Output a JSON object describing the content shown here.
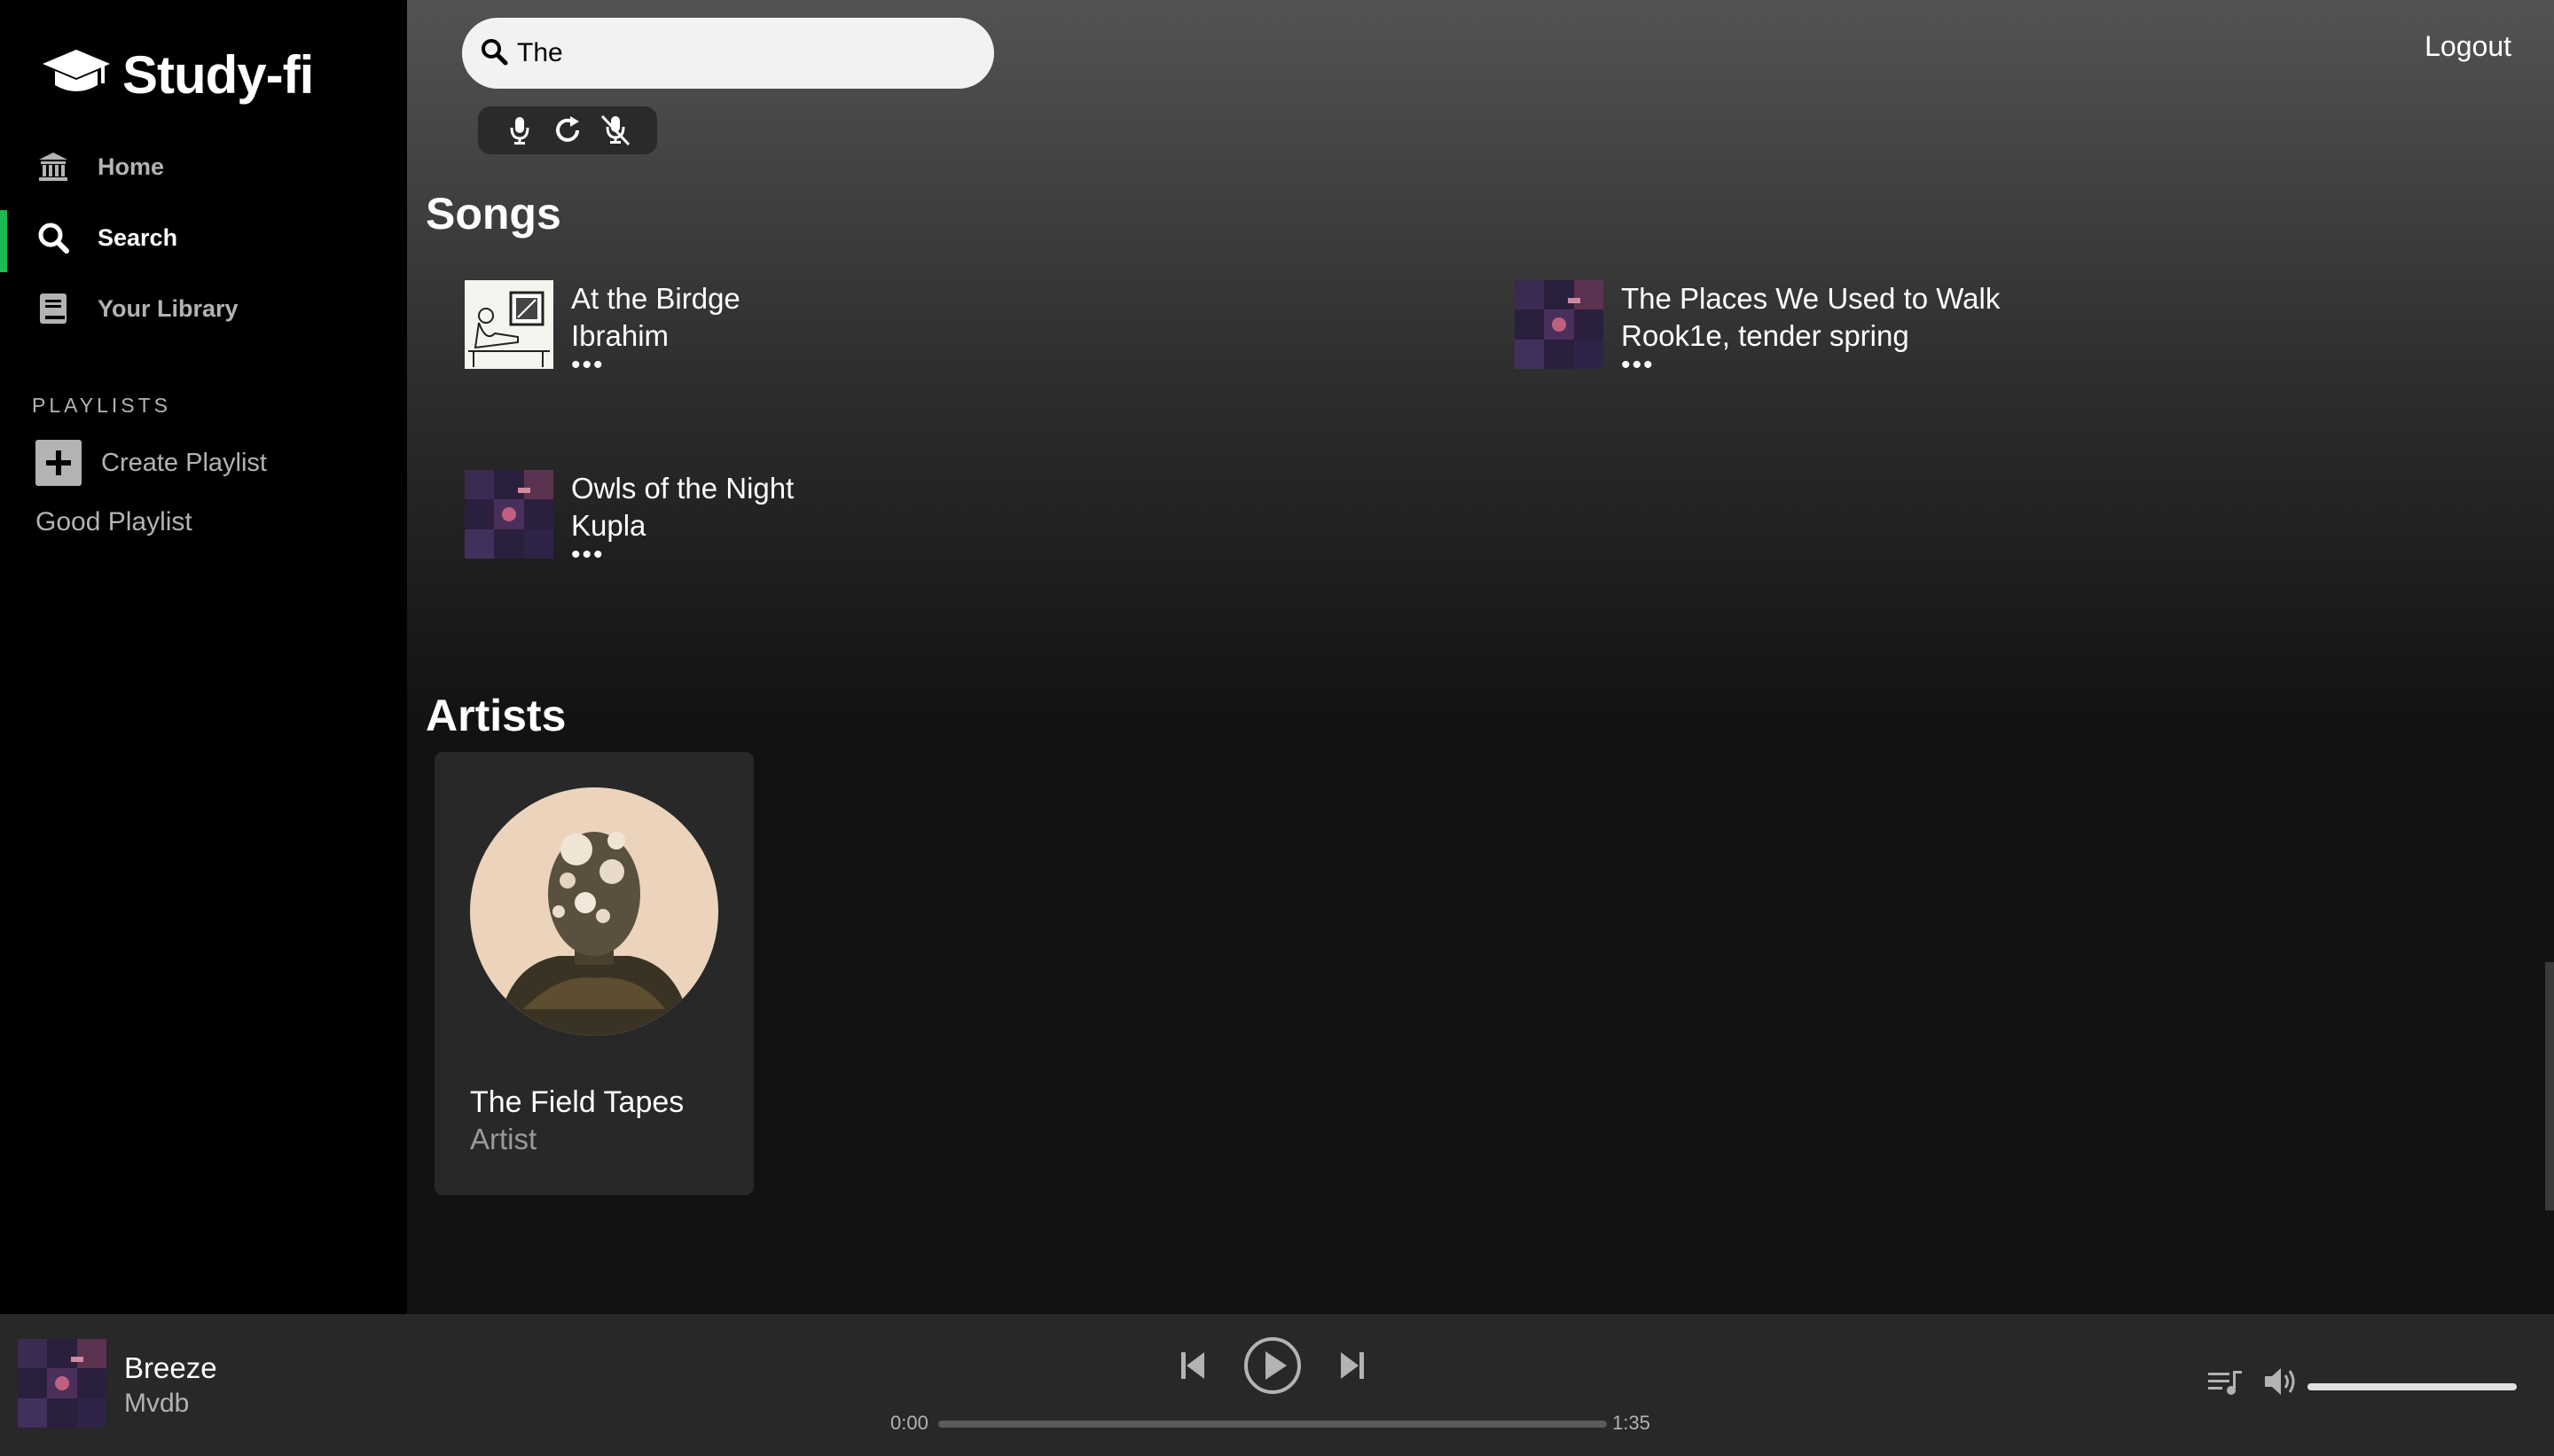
{
  "app": {
    "name": "Study-fi"
  },
  "sidebar": {
    "items": [
      {
        "label": "Home",
        "icon": "home-bank-icon"
      },
      {
        "label": "Search",
        "icon": "search-icon",
        "active": true
      },
      {
        "label": "Your Library",
        "icon": "library-book-icon"
      }
    ],
    "playlists_heading": "PLAYLISTS",
    "create_playlist": "Create Playlist",
    "playlists": [
      "Good Playlist"
    ]
  },
  "header": {
    "search_value": "The",
    "logout": "Logout",
    "voice_controls": [
      "microphone-icon",
      "refresh-icon",
      "microphone-off-icon"
    ]
  },
  "songs": {
    "title": "Songs",
    "items": [
      {
        "title": "At the Birdge",
        "artist": "Ibrahim",
        "more": "•••"
      },
      {
        "title": "The Places We Used to Walk",
        "artist": "Rook1e, tender spring",
        "more": "•••"
      },
      {
        "title": "Owls of the Night",
        "artist": "Kupla",
        "more": "•••"
      }
    ]
  },
  "artists": {
    "title": "Artists",
    "items": [
      {
        "name": "The Field Tapes",
        "type": "Artist"
      }
    ]
  },
  "player": {
    "title": "Breeze",
    "artist": "Mvdb",
    "current_time": "0:00",
    "duration": "1:35",
    "progress": 0,
    "volume": 1.0
  },
  "colors": {
    "accent": "#1db954",
    "sidebar_bg": "#000000",
    "player_bg": "#282828",
    "card_bg": "#282828"
  }
}
